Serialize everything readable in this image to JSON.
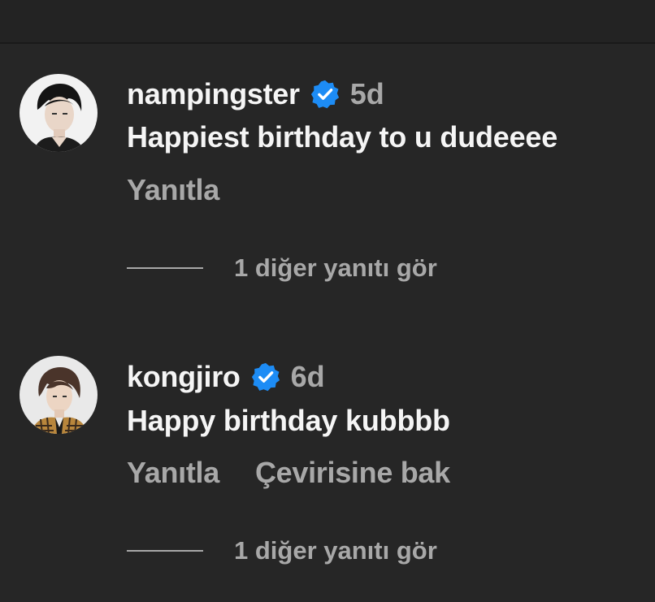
{
  "comments": [
    {
      "username": "nampingster",
      "verified": true,
      "time": "5d",
      "text": "Happiest birthday to u dudeeee",
      "actions": [
        "Yanıtla"
      ],
      "view_replies": "1 diğer yanıtı gör"
    },
    {
      "username": "kongjiro",
      "verified": true,
      "time": "6d",
      "text": "Happy birthday kubbbb",
      "actions": [
        "Yanıtla",
        "Çevirisine bak"
      ],
      "view_replies": "1 diğer yanıtı gör"
    }
  ],
  "colors": {
    "background": "#262626",
    "primary_text": "#f5f5f5",
    "secondary_text": "#a8a8a8",
    "verified_badge": "#1d8cf5"
  },
  "icons": {
    "verified": "verified-badge-icon"
  }
}
